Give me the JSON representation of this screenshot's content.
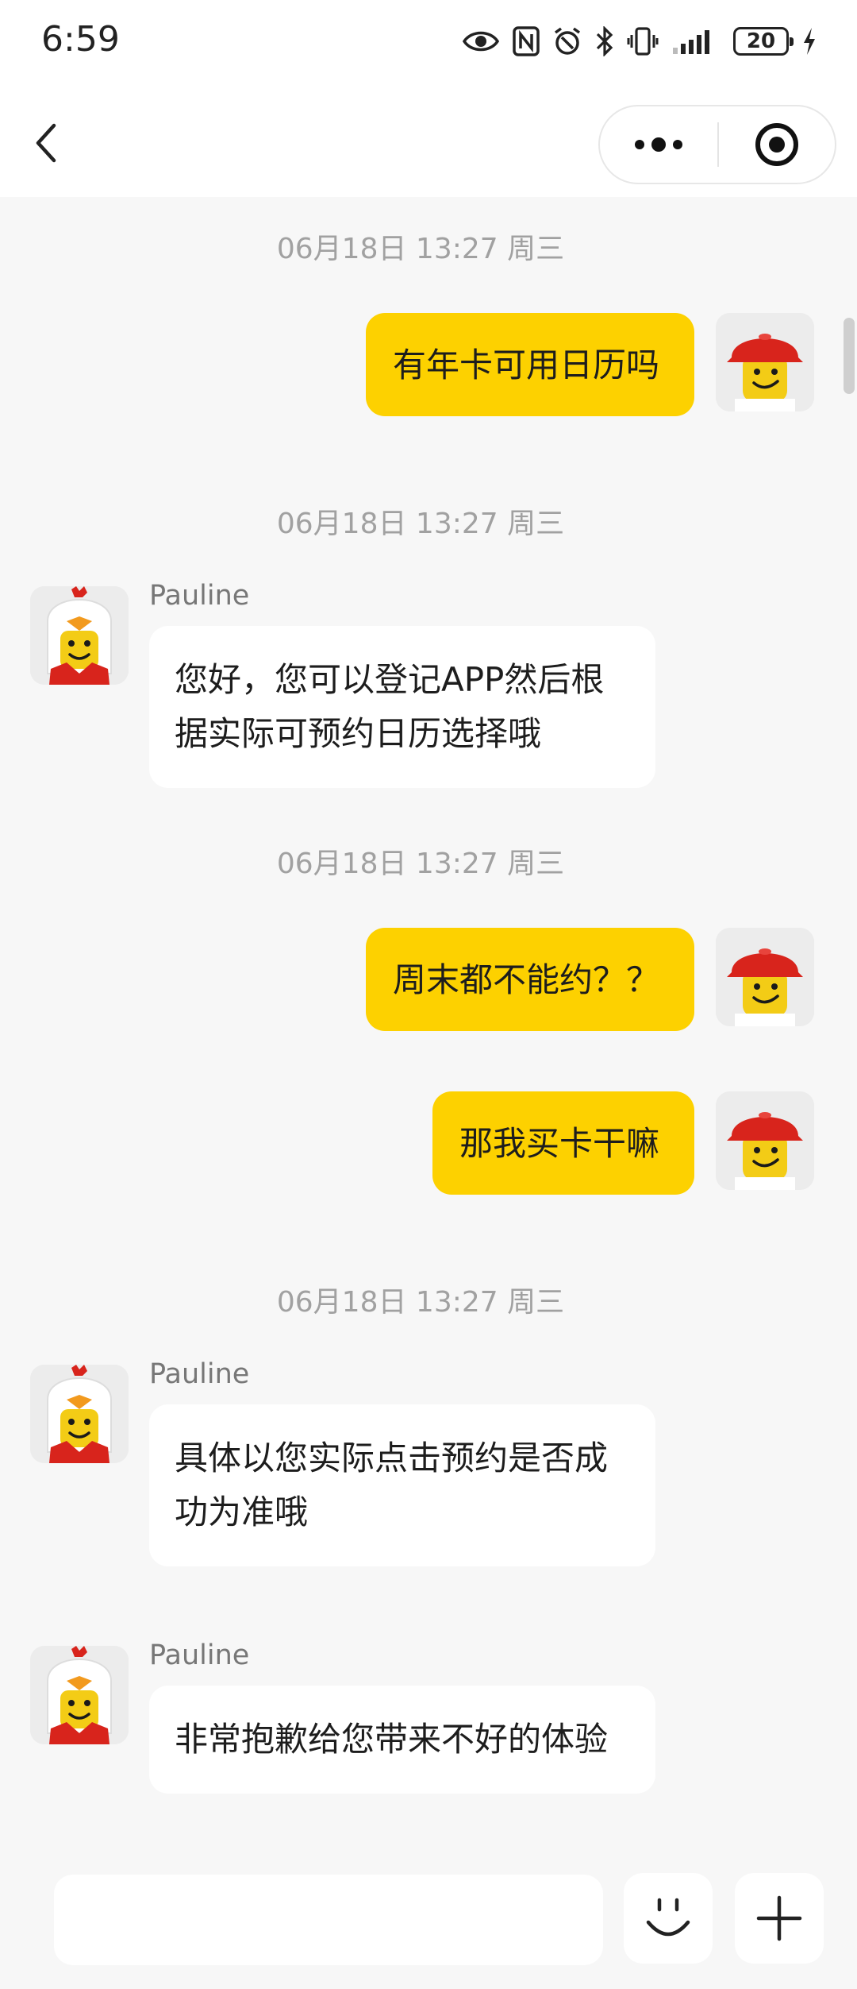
{
  "status_bar": {
    "time": "6:59",
    "battery_level": "20",
    "icons": [
      "eye-icon",
      "nfc-icon",
      "alarm-icon",
      "bluetooth-icon",
      "vibrate-icon",
      "signal-icon",
      "battery-icon",
      "charging-icon"
    ]
  },
  "nav": {
    "back_icon": "chevron-left-icon",
    "more_icon": "more-dots-icon",
    "close_icon": "target-close-icon"
  },
  "colors": {
    "accent_bubble": "#fdd100",
    "background": "#f7f7f7",
    "incoming_bubble": "#ffffff"
  },
  "messages": [
    {
      "type": "timestamp",
      "text": "06月18日 13:27 周三"
    },
    {
      "type": "outgoing",
      "text": "有年卡可用日历吗"
    },
    {
      "type": "timestamp",
      "text": "06月18日 13:27 周三"
    },
    {
      "type": "incoming",
      "sender": "Pauline",
      "text": "您好，您可以登记APP然后根据实际可预约日历选择哦"
    },
    {
      "type": "timestamp",
      "text": "06月18日 13:27 周三"
    },
    {
      "type": "outgoing",
      "text": "周末都不能约？？"
    },
    {
      "type": "outgoing",
      "text": "那我买卡干嘛"
    },
    {
      "type": "timestamp",
      "text": "06月18日 13:27 周三"
    },
    {
      "type": "incoming",
      "sender": "Pauline",
      "text": "具体以您实际点击预约是否成功为准哦"
    },
    {
      "type": "incoming",
      "sender": "Pauline",
      "text": "非常抱歉给您带来不好的体验"
    }
  ],
  "input": {
    "value": "",
    "placeholder": "",
    "emoji_icon": "smiley-icon",
    "plus_icon": "plus-icon"
  }
}
